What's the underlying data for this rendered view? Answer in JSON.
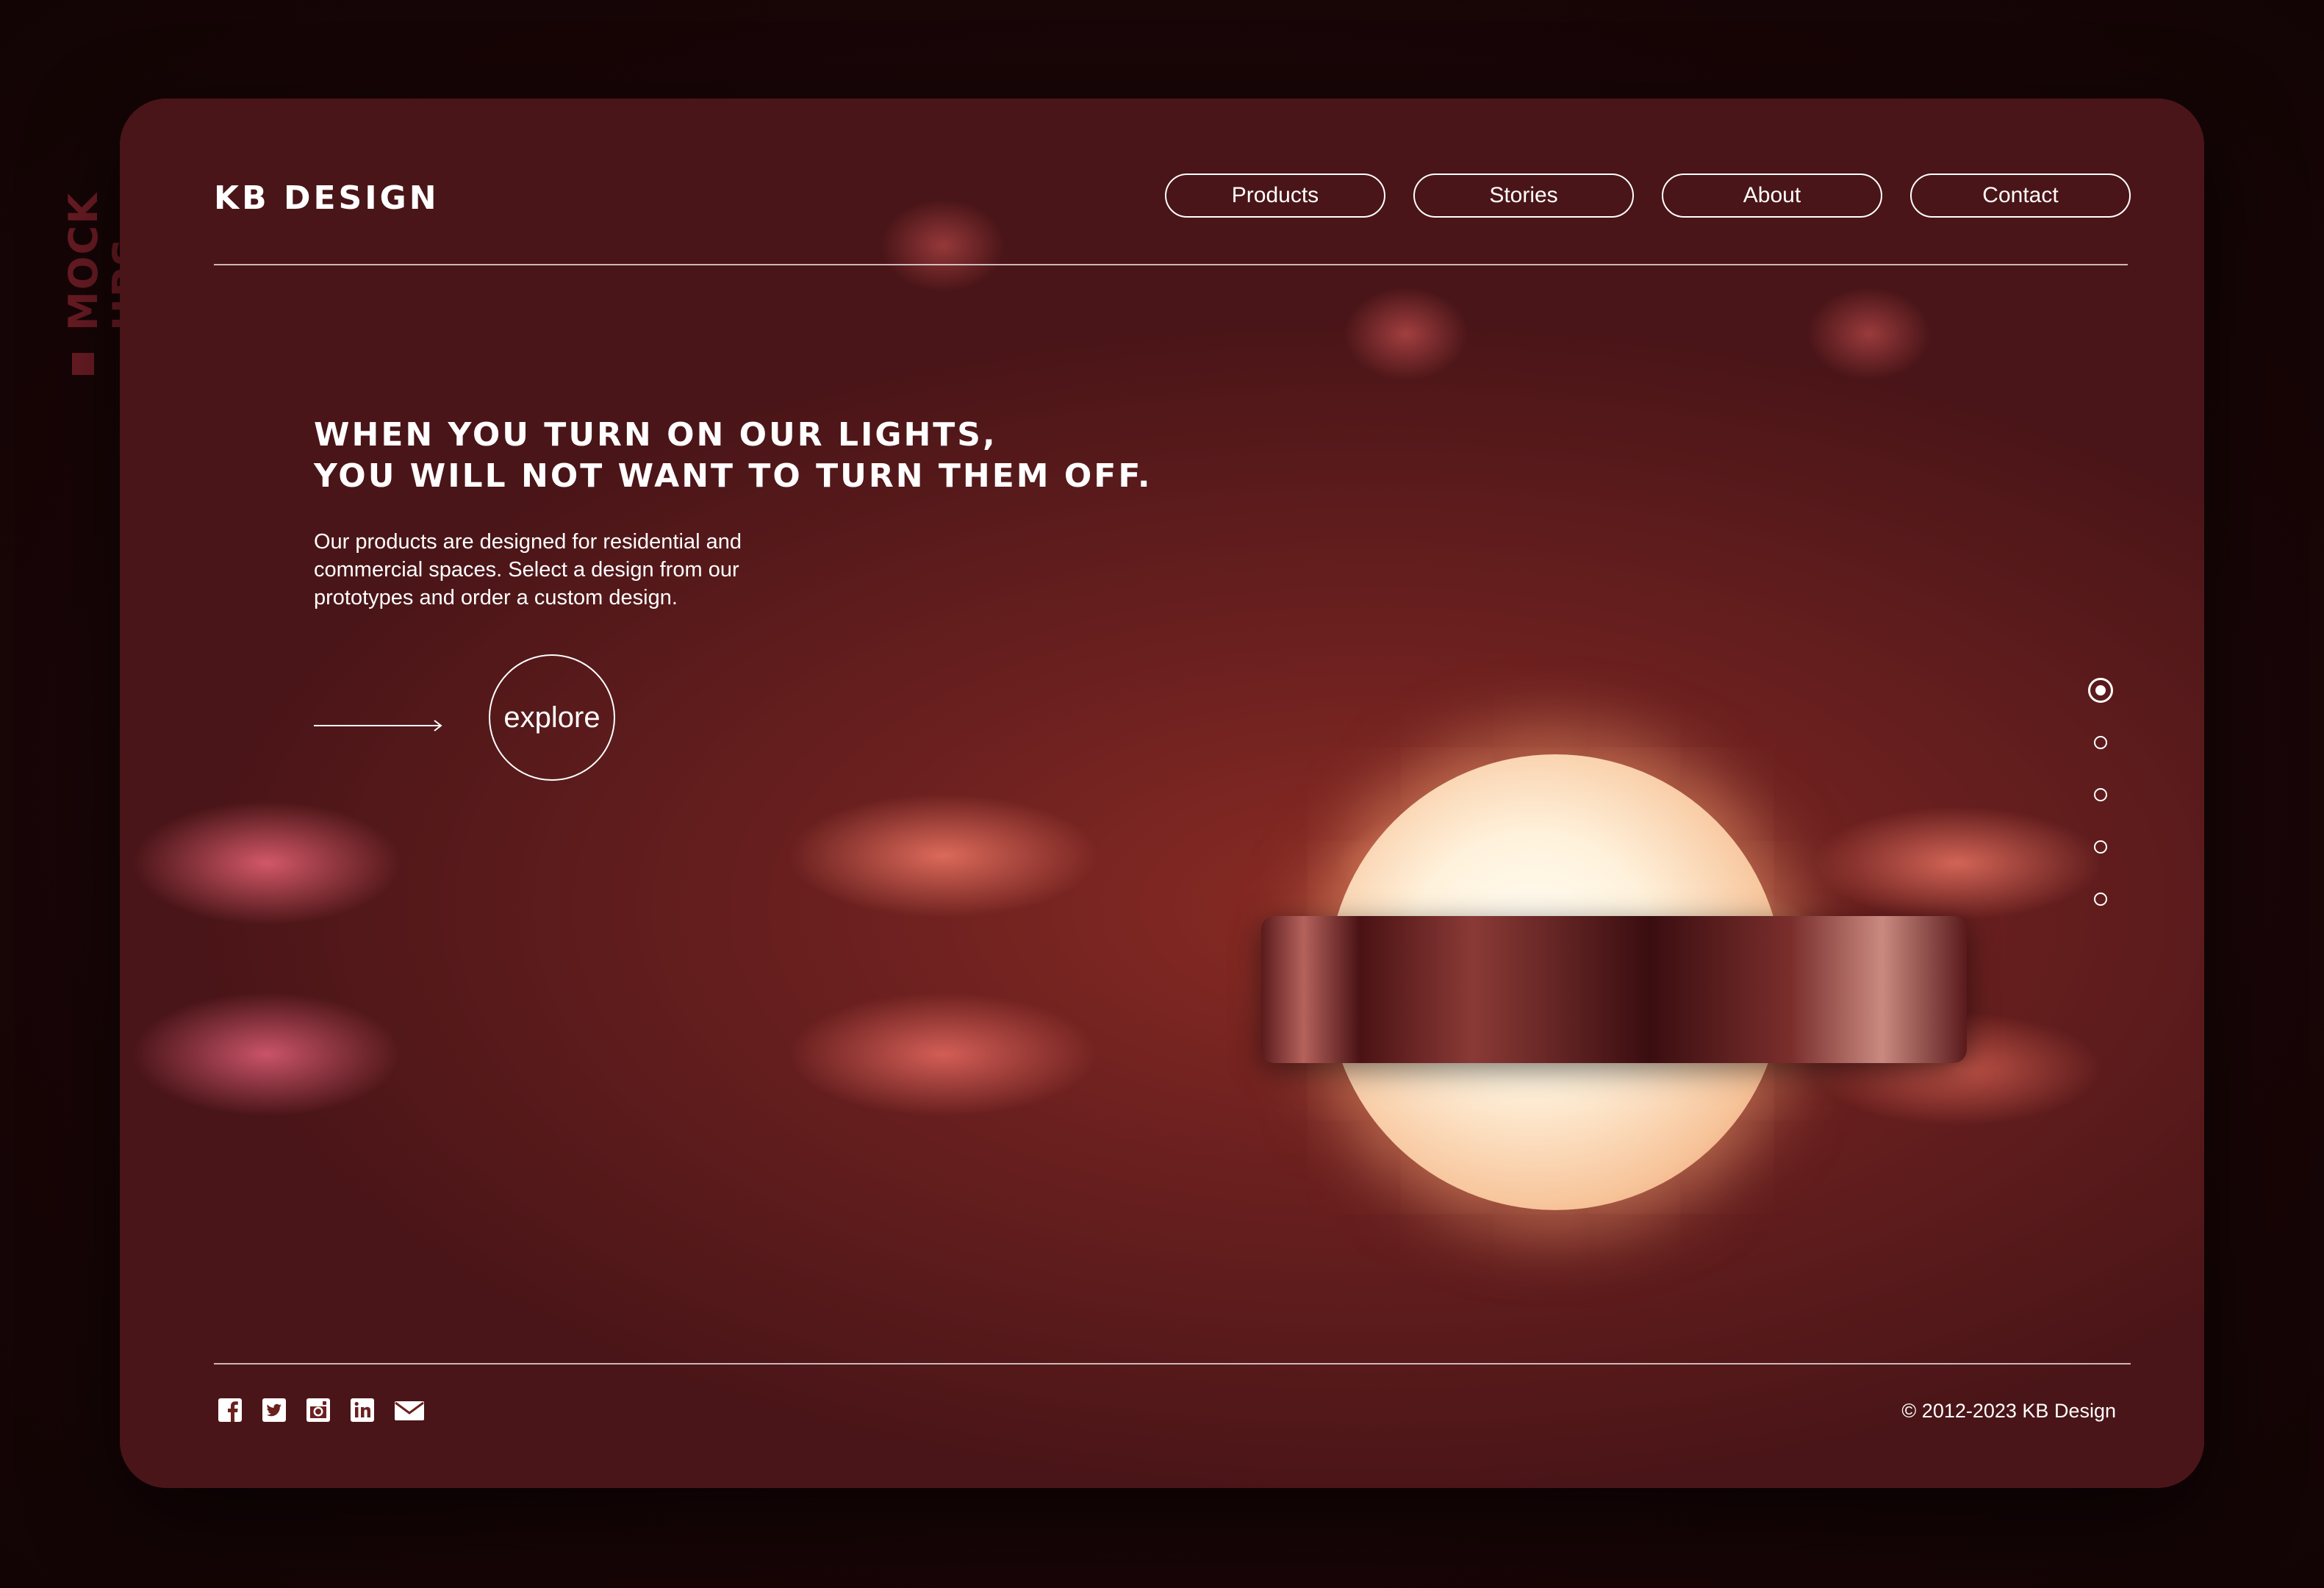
{
  "side_label": "MOCK UPS",
  "brand": "KB DESIGN",
  "nav": {
    "items": [
      {
        "label": "Products"
      },
      {
        "label": "Stories"
      },
      {
        "label": "About"
      },
      {
        "label": "Contact"
      }
    ]
  },
  "hero": {
    "headline_line1": "WHEN YOU TURN ON OUR LIGHTS,",
    "headline_line2": "YOU WILL NOT WANT TO TURN THEM OFF.",
    "body_line1": "Our products are designed for residential and",
    "body_line2": "commercial spaces. Select a design from our",
    "body_line3": "prototypes and order a custom design.",
    "cta_label": "explore"
  },
  "slider": {
    "total": 5,
    "active_index": 0
  },
  "footer": {
    "social_icons": [
      "facebook-icon",
      "twitter-icon",
      "instagram-icon",
      "linkedin-icon",
      "email-icon"
    ],
    "copyright": "© 2012-2023 KB Design"
  },
  "colors": {
    "page_bg": "#1e0809",
    "side_label": "#6b1c24",
    "text": "#ffffff",
    "card_base": "#6b201f",
    "glow": "#fff2dc"
  }
}
